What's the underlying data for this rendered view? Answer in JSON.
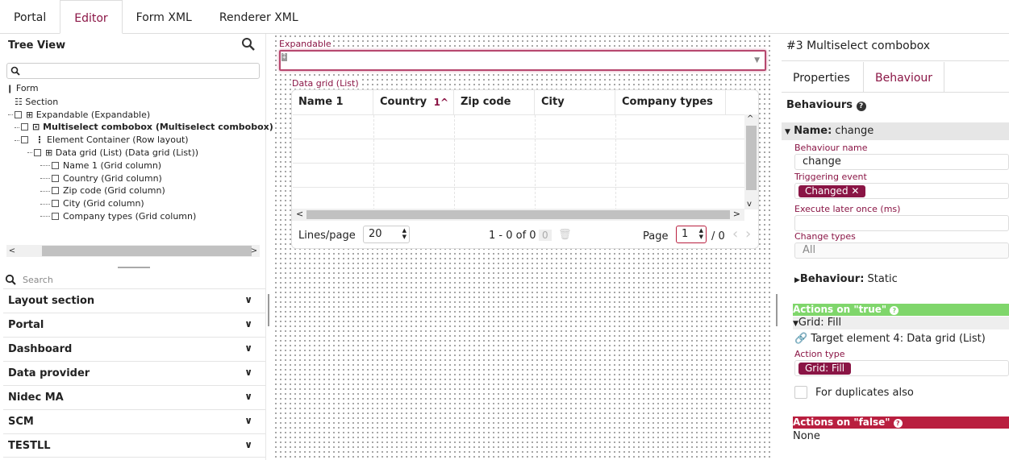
{
  "tabs": [
    "Portal",
    "Editor",
    "Form XML",
    "Renderer XML"
  ],
  "active_tab": "Editor",
  "tree_view": {
    "title": "Tree View",
    "nodes": [
      "Form",
      "Section",
      "Expandable (Expandable)",
      "Multiselect combobox (Multiselect combobox)",
      "Element Container (Row layout)",
      "Data grid (List) (Data grid (List))",
      "Name 1 (Grid column)",
      "Country (Grid column)",
      "Zip code (Grid column)",
      "City (Grid column)",
      "Company types (Grid column)"
    ]
  },
  "library": {
    "search_placeholder": "Search",
    "sections": [
      "Layout section",
      "Portal",
      "Dashboard",
      "Data provider",
      "Nidec MA",
      "SCM",
      "TESTLL"
    ]
  },
  "canvas": {
    "expandable_label": "Expandable",
    "grid_label": "Data grid (List)",
    "columns": [
      "Name 1",
      "Country",
      "Zip code",
      "City",
      "Company types"
    ],
    "sort_indicator": "1^",
    "lines_per_page_label": "Lines/page",
    "lines_per_page": "20",
    "range_text": "1 - 0 of 0",
    "selected_count": "0",
    "page_label": "Page",
    "page_value": "1",
    "page_total": "/ 0"
  },
  "props": {
    "element_title": "#3 Multiselect combobox",
    "tabs": [
      "Properties",
      "Behaviour"
    ],
    "active_tab": "Behaviour",
    "behaviours_title": "Behaviours",
    "name_key": "Name:",
    "name_value": "change",
    "behaviour_name_label": "Behaviour name",
    "behaviour_name": "change",
    "triggering_event_label": "Triggering event",
    "triggering_event": "Changed",
    "execute_later_label": "Execute later once (ms)",
    "execute_later": "",
    "change_types_label": "Change types",
    "change_types": "All",
    "behaviour_key": "Behaviour:",
    "behaviour_value": "Static",
    "actions_true": "Actions on \"true\"",
    "grid_fill_header": "Grid: Fill",
    "target_element": "Target element 4: Data grid (List)",
    "action_type_label": "Action type",
    "action_type": "Grid: Fill",
    "duplicates_label": "For duplicates also",
    "actions_false": "Actions on \"false\"",
    "false_value": "None"
  },
  "colors": {
    "accent": "#8a1545",
    "true_bar": "#7fd66b",
    "false_bar": "#b91f3f"
  }
}
